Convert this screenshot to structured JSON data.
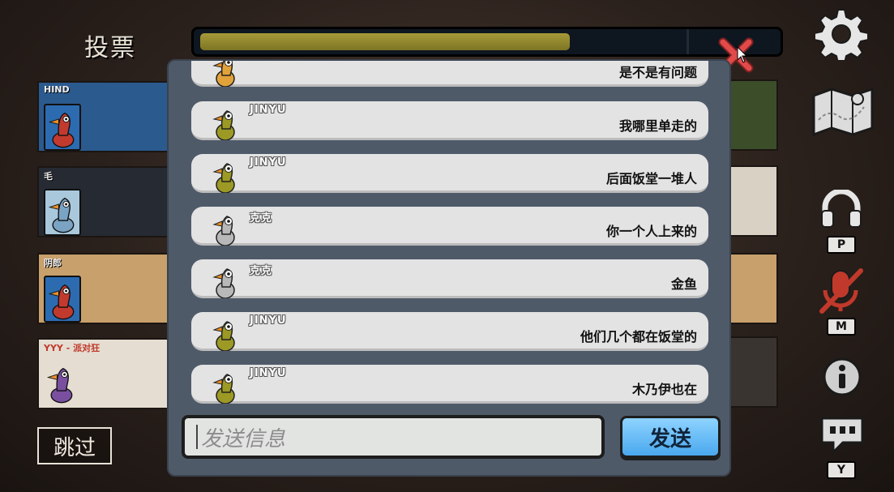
{
  "header": {
    "title": "投票",
    "timer_progress": 0.63
  },
  "players": [
    {
      "name": "HIND",
      "portrait_color": "#c23a2e",
      "bg": "#2b5a8e"
    },
    {
      "name": "毛",
      "portrait_color": "#7aa3c4",
      "bg": "#262a33"
    },
    {
      "name": "阴郎",
      "portrait_color": "#c23a2e",
      "bg": "#c8a06c"
    },
    {
      "name": "YYY - 派对狂",
      "portrait_color": "#7a4fa0",
      "bg": "#e5ddd1"
    }
  ],
  "skip_button": {
    "label": "跳过"
  },
  "sidebar": {
    "settings_icon": "gear-icon",
    "map_icon": "map-icon",
    "headset_key": "P",
    "mic_key": "M",
    "chat_key": "Y"
  },
  "chat": {
    "messages": [
      {
        "sender": "",
        "text": "是不是有问题",
        "avatar": "#e2a23a"
      },
      {
        "sender": "JINYU",
        "text": "我哪里单走的",
        "avatar": "#9c9a24"
      },
      {
        "sender": "JINYU",
        "text": "后面饭堂一堆人",
        "avatar": "#9c9a24"
      },
      {
        "sender": "克克",
        "text": "你一个人上来的",
        "avatar": "#b8b8b8"
      },
      {
        "sender": "克克",
        "text": "金鱼",
        "avatar": "#b8b8b8"
      },
      {
        "sender": "JINYU",
        "text": "他们几个都在饭堂的",
        "avatar": "#9c9a24"
      },
      {
        "sender": "JINYU",
        "text": "木乃伊也在",
        "avatar": "#9c9a24"
      }
    ],
    "input_placeholder": "发送信息",
    "send_label": "发送"
  }
}
